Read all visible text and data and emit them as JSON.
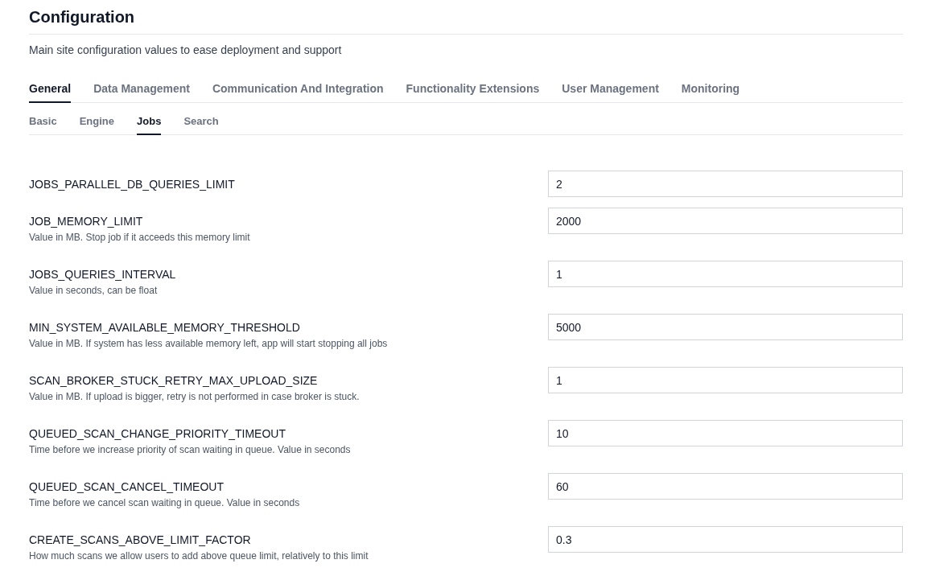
{
  "title": "Configuration",
  "subtitle": "Main site configuration values to ease deployment and support",
  "tabs": [
    {
      "label": "General",
      "selected": true
    },
    {
      "label": "Data Management",
      "selected": false
    },
    {
      "label": "Communication And Integration",
      "selected": false
    },
    {
      "label": "Functionality Extensions",
      "selected": false
    },
    {
      "label": "User Management",
      "selected": false
    },
    {
      "label": "Monitoring",
      "selected": false
    }
  ],
  "subtabs": [
    {
      "label": "Basic",
      "selected": false
    },
    {
      "label": "Engine",
      "selected": false
    },
    {
      "label": "Jobs",
      "selected": true
    },
    {
      "label": "Search",
      "selected": false
    }
  ],
  "settings": [
    {
      "name": "JOBS_PARALLEL_DB_QUERIES_LIMIT",
      "value": "2"
    },
    {
      "name": "JOB_MEMORY_LIMIT",
      "description": "Value in MB. Stop job if it acceeds this memory limit",
      "value": "2000"
    },
    {
      "name": "JOBS_QUERIES_INTERVAL",
      "description": "Value in seconds, can be float",
      "value": "1"
    },
    {
      "name": "MIN_SYSTEM_AVAILABLE_MEMORY_THRESHOLD",
      "description": "Value in MB. If system has less available memory left, app will start stopping all jobs",
      "value": "5000"
    },
    {
      "name": "SCAN_BROKER_STUCK_RETRY_MAX_UPLOAD_SIZE",
      "description": "Value in MB. If upload is bigger, retry is not performed in case broker is stuck.",
      "value": "1"
    },
    {
      "name": "QUEUED_SCAN_CHANGE_PRIORITY_TIMEOUT",
      "description": "Time before we increase priority of scan waiting in queue. Value in seconds",
      "value": "10"
    },
    {
      "name": "QUEUED_SCAN_CANCEL_TIMEOUT",
      "description": "Time before we cancel scan waiting in queue. Value in seconds",
      "value": "60"
    },
    {
      "name": "CREATE_SCANS_ABOVE_LIMIT_FACTOR",
      "description": "How much scans we allow users to add above queue limit, relatively to this limit",
      "value": "0.3"
    }
  ]
}
